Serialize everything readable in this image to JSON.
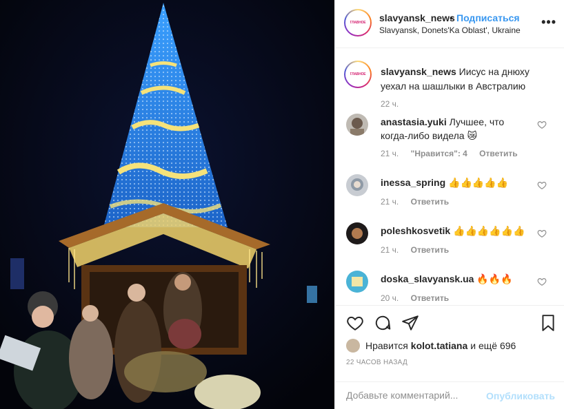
{
  "header": {
    "username": "slavyansk_news",
    "dot": "•",
    "follow_label": "Подписаться",
    "location": "Slavyansk, Donets'Ka Oblast', Ukraine",
    "more_icon": "more-horizontal-icon"
  },
  "caption": {
    "username": "slavyansk_news",
    "text": "Иисус на днюху уехал на шашлыки в Австралию",
    "time": "22 ч."
  },
  "comments": [
    {
      "username": "anastasia.yuki",
      "text": "Лучшее, что когда-либо видела 😿",
      "time": "21 ч.",
      "likes": "\"Нравится\": 4",
      "reply": "Ответить"
    },
    {
      "username": "inessa_spring",
      "text": "👍👍👍👍👍",
      "time": "21 ч.",
      "likes": "",
      "reply": "Ответить"
    },
    {
      "username": "poleshkosvetik",
      "text": "👍👍👍👍👍👍",
      "time": "21 ч.",
      "likes": "",
      "reply": "Ответить"
    },
    {
      "username": "doska_slavyansk.ua",
      "text": "🔥🔥🔥",
      "time": "20 ч.",
      "likes": "",
      "reply": "Ответить"
    }
  ],
  "actions": {
    "icons": [
      "heart-icon",
      "comment-icon",
      "share-icon",
      "bookmark-icon"
    ],
    "likes_prefix": "Нравится",
    "likes_user": "kolot.tatiana",
    "likes_suffix": "и ещё 696",
    "time_ago": "22 ЧАСОВ НАЗАД"
  },
  "add_comment": {
    "placeholder": "Добавьте комментарий...",
    "publish_label": "Опубликовать"
  },
  "colors": {
    "link": "#3897f0",
    "muted": "#8e8e8e",
    "publish_disabled": "#b2dffc"
  }
}
